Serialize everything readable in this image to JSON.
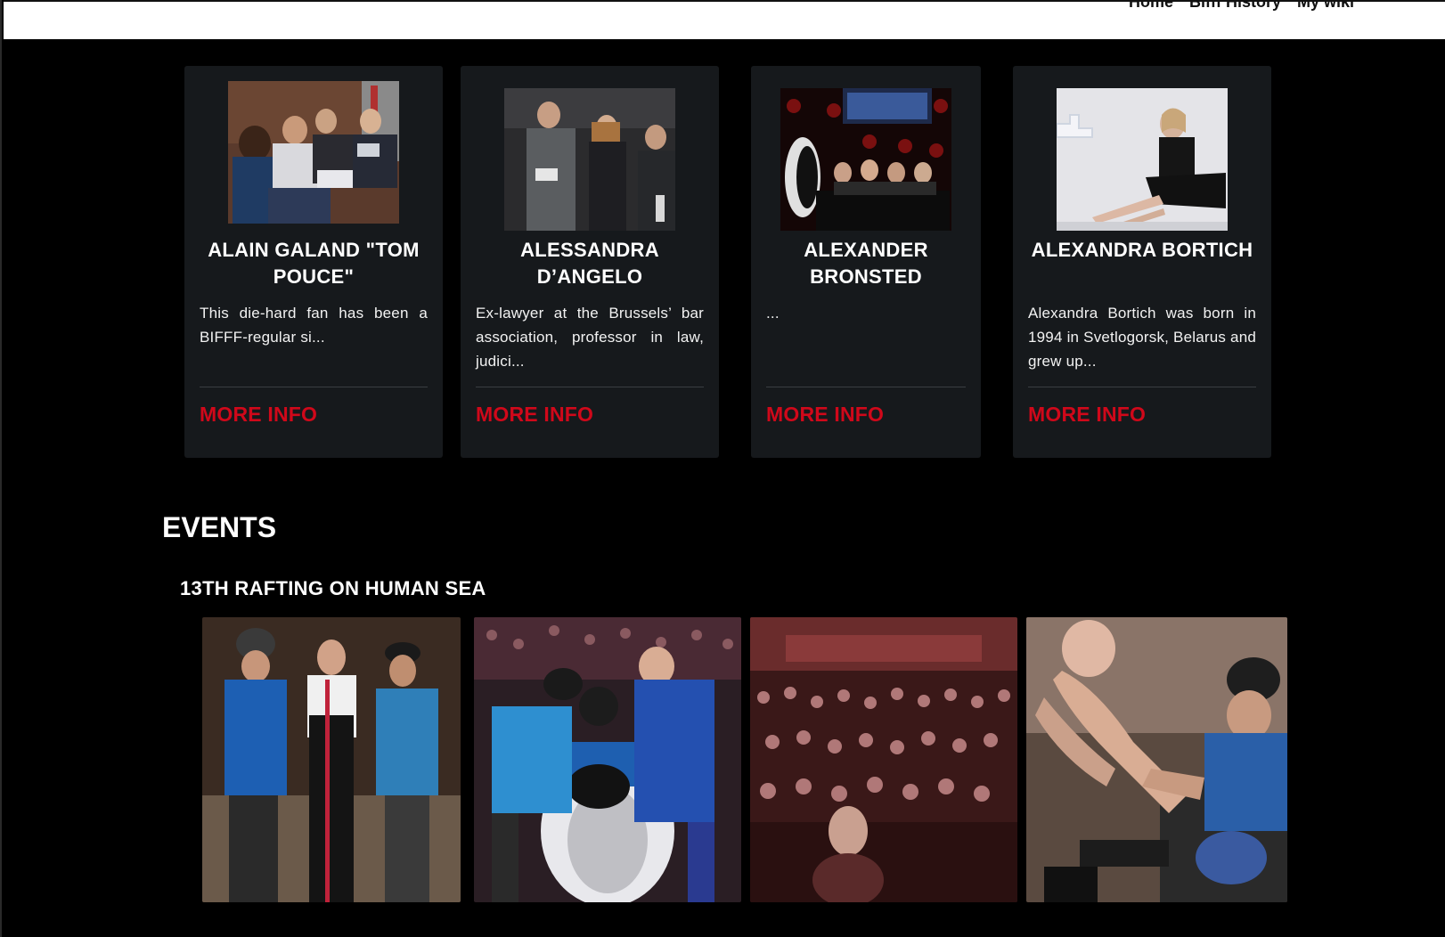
{
  "nav": {
    "items": [
      "Home",
      "Bifff History",
      "My wiki"
    ]
  },
  "guests": [
    {
      "name": "ALAIN GALAND \"TOM POUCE\"",
      "excerpt": "This die-hard fan has been a BIFFF-regular si...",
      "more_label": "MORE INFO"
    },
    {
      "name": "ALESSANDRA D’ANGELO",
      "excerpt": "Ex-lawyer at the Brussels’ bar association, professor in law, judici...",
      "more_label": "MORE INFO"
    },
    {
      "name": "ALEXANDER BRONSTED",
      "excerpt": "...",
      "more_label": "MORE INFO"
    },
    {
      "name": "ALEXANDRA BORTICH",
      "excerpt": "Alexandra Bortich was born in 1994 in Svetlogorsk, Belarus and grew up...",
      "more_label": "MORE INFO"
    }
  ],
  "events": {
    "section_title": "EVENTS",
    "items": [
      {
        "title": "13TH RAFTING ON HUMAN SEA",
        "photos": 4
      }
    ]
  },
  "colors": {
    "accent": "#d0081a",
    "card_bg": "#16191c",
    "page_bg": "#000000"
  }
}
